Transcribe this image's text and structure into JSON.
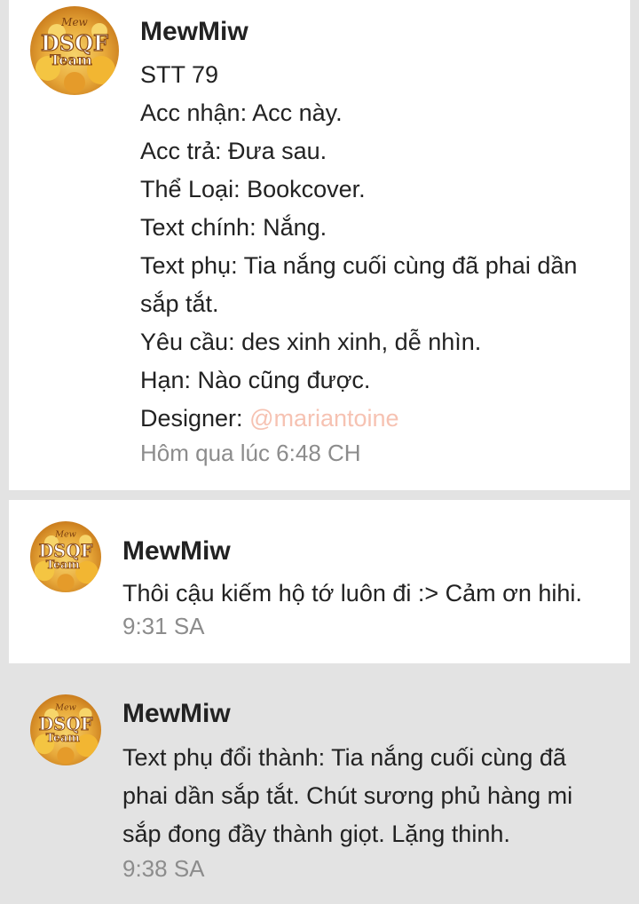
{
  "messages": [
    {
      "author": "MewMiw",
      "avatar_icon": "avatar-icon",
      "avatar_logo_text": {
        "top": "Mew",
        "main": "DSQF",
        "sub": "Team"
      },
      "lines": [
        "STT 79",
        "Acc nhận: Acc này.",
        "Acc trả: Đưa sau.",
        "Thể Loại: Bookcover.",
        "Text chính: Nắng.",
        "Text phụ: Tia nắng cuối cùng đã phai dần sắp tắt.",
        "Yêu cầu: des xinh xinh, dễ nhìn.",
        "Hạn: Nào cũng được."
      ],
      "designer_label": "Designer: ",
      "designer_mention": "@mariantoine",
      "time": "Hôm qua lúc 6:48 CH"
    },
    {
      "author": "MewMiw",
      "avatar_icon": "avatar-icon",
      "text": "Thôi cậu kiếm hộ tớ luôn đi :> Cảm ơn hihi.",
      "time": "9:31 SA"
    },
    {
      "author": "MewMiw",
      "avatar_icon": "avatar-icon",
      "text": "Text phụ đổi thành: Tia nắng cuối cùng đã phai dần sắp tắt. Chút sương phủ hàng mi sắp đong đầy thành giọt. Lặng thinh.",
      "time": "9:38 SA"
    }
  ],
  "colors": {
    "background": "#e3e3e3",
    "card": "#ffffff",
    "mention": "#f6c2b2",
    "timestamp": "#8c8c8c"
  }
}
